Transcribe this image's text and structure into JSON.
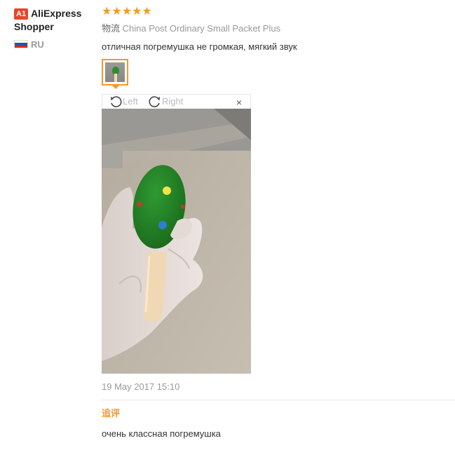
{
  "user": {
    "level_badge": "A1",
    "name": "AliExpress Shopper",
    "country_code": "RU",
    "flag_colors": [
      "#ffffff",
      "#1c57a8",
      "#d52b1e"
    ]
  },
  "review": {
    "rating": 5,
    "stars": "★★★★★",
    "star_color": "#f59a23",
    "shipping_label": "物流",
    "shipping_method": "China Post Ordinary Small Packet Plus",
    "feedback": "отличная погремушка не громкая, мягкий звук",
    "viewer": {
      "rotate_left_label": "Left",
      "rotate_right_label": "Right",
      "close_label": "×"
    },
    "date": "19 May 2017 15:10",
    "followup": {
      "label": "追评",
      "text": "очень классная погремушка"
    }
  },
  "colors": {
    "accent": "#f59a23",
    "badge": "#e8452a"
  }
}
